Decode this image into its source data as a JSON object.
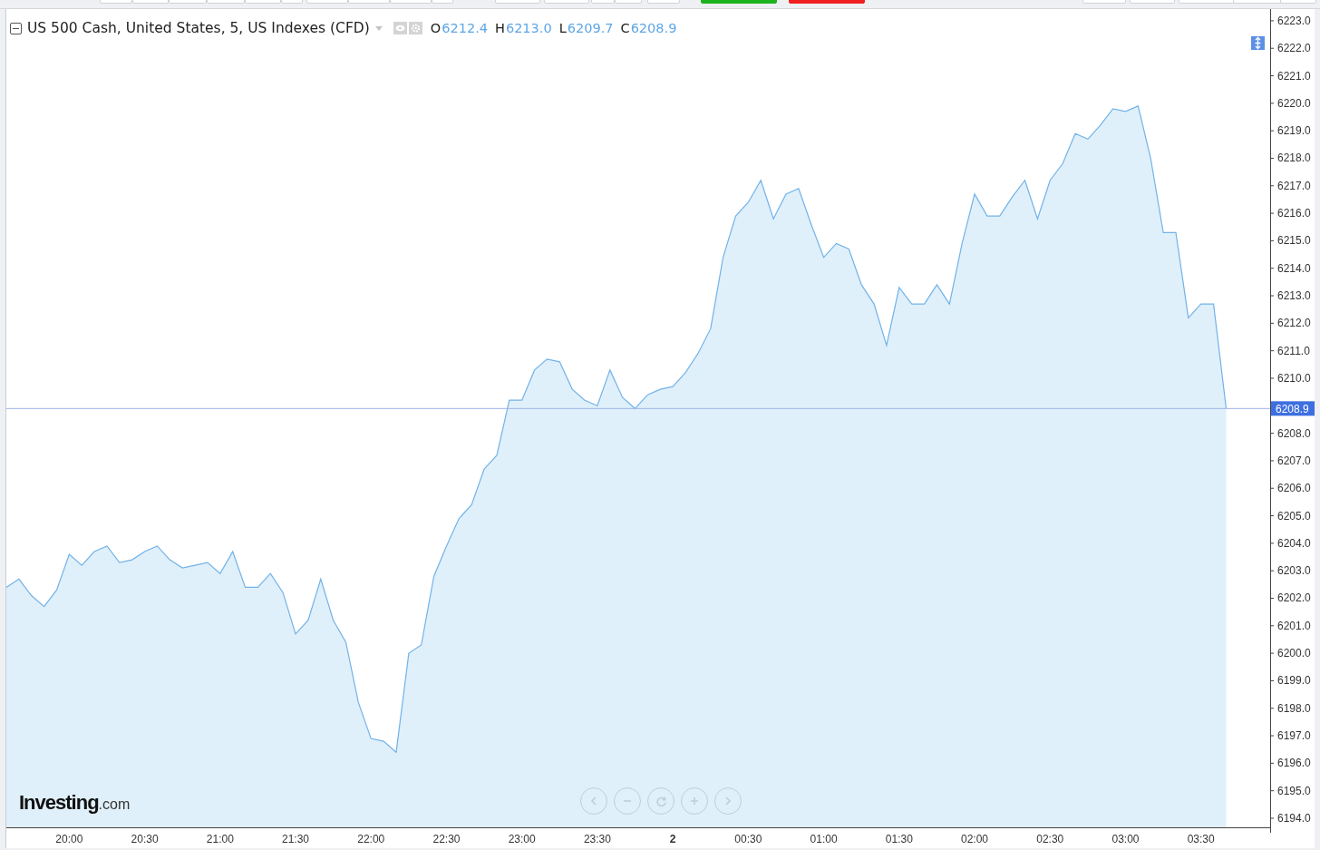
{
  "legend": {
    "title": "US 500 Cash, United States, 5, US Indexes (CFD)",
    "values": [
      {
        "label": "O",
        "value": "6212.4"
      },
      {
        "label": "H",
        "value": "6213.0"
      },
      {
        "label": "L",
        "value": "6209.7"
      },
      {
        "label": "C",
        "value": "6208.9"
      }
    ]
  },
  "last_price": "6208.9",
  "logo": {
    "name": "Investing",
    "suffix": ".com"
  },
  "chart_data": {
    "type": "area",
    "categories": [
      null,
      null,
      null,
      null,
      null,
      "20:00",
      null,
      null,
      null,
      null,
      null,
      "20:30",
      null,
      null,
      null,
      null,
      null,
      "21:00",
      null,
      null,
      null,
      null,
      null,
      "21:30",
      null,
      null,
      null,
      null,
      null,
      "22:00",
      null,
      null,
      null,
      null,
      null,
      "22:30",
      null,
      null,
      null,
      null,
      null,
      "23:00",
      null,
      null,
      null,
      null,
      null,
      "23:30",
      null,
      null,
      null,
      null,
      null,
      "2",
      null,
      null,
      null,
      null,
      null,
      "00:30",
      null,
      null,
      null,
      null,
      null,
      "01:00",
      null,
      null,
      null,
      null,
      null,
      "01:30",
      null,
      null,
      null,
      null,
      null,
      "02:00",
      null,
      null,
      null,
      null,
      null,
      "02:30",
      null,
      null,
      null,
      null,
      null,
      "03:00",
      null,
      null,
      null,
      null,
      null,
      "03:30",
      null,
      null
    ],
    "ref_lines": [
      {
        "axis": "y",
        "value": 6208.9
      }
    ],
    "series": [
      {
        "color": "#72b2e8",
        "values": [
          6202.4,
          6202.7,
          6202.1,
          6201.7,
          6202.3,
          6203.6,
          6203.2,
          6203.7,
          6203.9,
          6203.3,
          6203.4,
          6203.7,
          6203.9,
          6203.4,
          6203.1,
          6203.2,
          6203.3,
          6202.9,
          6203.7,
          6202.4,
          6202.4,
          6202.9,
          6202.2,
          6200.7,
          6201.2,
          6202.7,
          6201.2,
          6200.4,
          6198.2,
          6196.9,
          6196.8,
          6196.4,
          6200.0,
          6200.3,
          6202.8,
          6203.9,
          6204.9,
          6205.4,
          6206.7,
          6207.2,
          6209.2,
          6209.2,
          6210.3,
          6210.7,
          6210.6,
          6209.6,
          6209.2,
          6209.0,
          6210.3,
          6209.3,
          6208.9,
          6209.4,
          6209.6,
          6209.7,
          6210.2,
          6210.9,
          6211.8,
          6214.4,
          6215.9,
          6216.4,
          6217.2,
          6215.8,
          6216.7,
          6216.9,
          6215.6,
          6214.4,
          6214.9,
          6214.7,
          6213.4,
          6212.7,
          6211.2,
          6213.3,
          6212.7,
          6212.7,
          6213.4,
          6212.7,
          6214.9,
          6216.7,
          6215.9,
          6215.9,
          6216.6,
          6217.2,
          6215.8,
          6217.2,
          6217.8,
          6218.9,
          6218.7,
          6219.2,
          6219.8,
          6219.7,
          6219.9,
          6218.0,
          6215.3,
          6215.3,
          6212.2,
          6212.7,
          6212.7,
          6208.9
        ]
      }
    ],
    "ylim": [
      6193.67,
      6223.36
    ],
    "yticks": [
      {
        "value": 6194,
        "label": "6194.0"
      },
      {
        "value": 6195,
        "label": "6195.0"
      },
      {
        "value": 6196,
        "label": "6196.0"
      },
      {
        "value": 6197,
        "label": "6197.0"
      },
      {
        "value": 6198,
        "label": "6198.0"
      },
      {
        "value": 6199,
        "label": "6199.0"
      },
      {
        "value": 6200,
        "label": "6200.0"
      },
      {
        "value": 6201,
        "label": "6201.0"
      },
      {
        "value": 6202,
        "label": "6202.0"
      },
      {
        "value": 6203,
        "label": "6203.0"
      },
      {
        "value": 6204,
        "label": "6204.0"
      },
      {
        "value": 6205,
        "label": "6205.0"
      },
      {
        "value": 6206,
        "label": "6206.0"
      },
      {
        "value": 6207,
        "label": "6207.0"
      },
      {
        "value": 6208,
        "label": "6208.0"
      },
      {
        "value": 6210,
        "label": "6210.0"
      },
      {
        "value": 6211,
        "label": "6211.0"
      },
      {
        "value": 6212,
        "label": "6212.0"
      },
      {
        "value": 6213,
        "label": "6213.0"
      },
      {
        "value": 6214,
        "label": "6214.0"
      },
      {
        "value": 6215,
        "label": "6215.0"
      },
      {
        "value": 6216,
        "label": "6216.0"
      },
      {
        "value": 6217,
        "label": "6217.0"
      },
      {
        "value": 6218,
        "label": "6218.0"
      },
      {
        "value": 6219,
        "label": "6219.0"
      },
      {
        "value": 6220,
        "label": "6220.0"
      },
      {
        "value": 6221,
        "label": "6221.0"
      },
      {
        "value": 6222,
        "label": "6222.0"
      },
      {
        "value": 6223,
        "label": "6223.0"
      }
    ]
  }
}
